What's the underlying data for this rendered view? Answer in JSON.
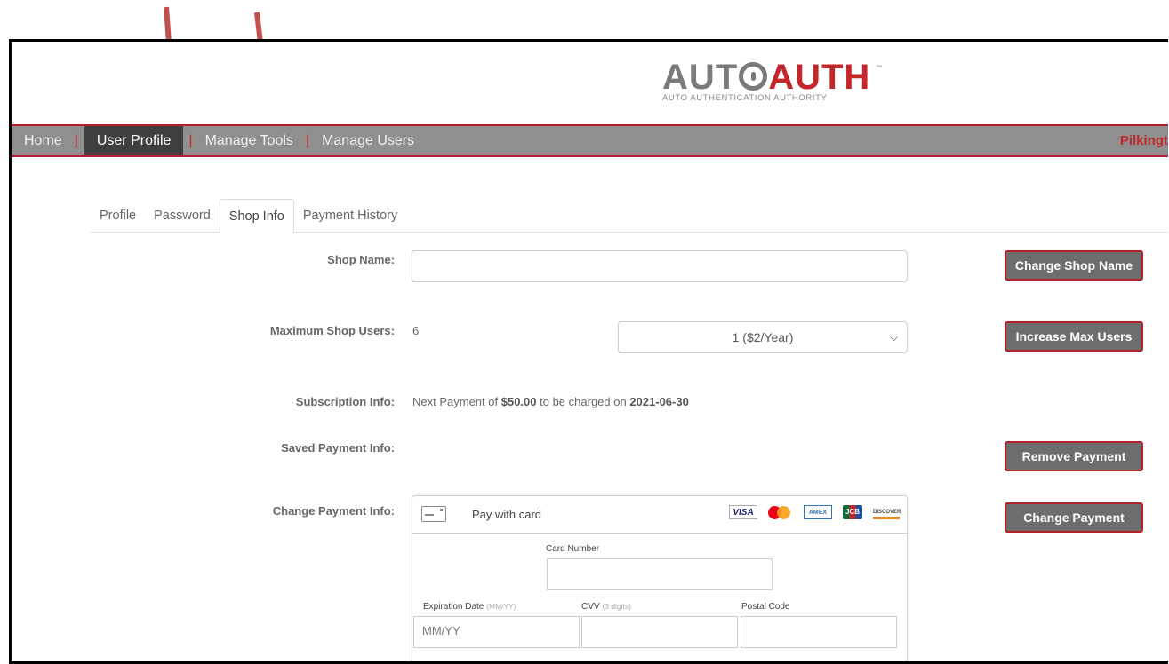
{
  "logo": {
    "part1": "AUT",
    "part2": "AUTH",
    "tm": "™",
    "subtitle": "AUTO AUTHENTICATION AUTHORITY"
  },
  "nav": {
    "items": [
      {
        "label": "Home"
      },
      {
        "label": "User Profile"
      },
      {
        "label": "Manage Tools"
      },
      {
        "label": "Manage Users"
      }
    ],
    "separator": "|",
    "user": "Pilkingt"
  },
  "tabs": [
    {
      "label": "Profile"
    },
    {
      "label": "Password"
    },
    {
      "label": "Shop Info"
    },
    {
      "label": "Payment History"
    }
  ],
  "shop": {
    "name_label": "Shop Name:",
    "name_value": "",
    "change_name_button": "Change Shop Name",
    "max_users_label": "Maximum Shop Users:",
    "max_users_value": "6",
    "max_users_select": "1 ($2/Year)",
    "increase_button": "Increase Max Users",
    "subscription_label": "Subscription Info:",
    "subscription_prefix": "Next Payment of",
    "subscription_amount": "$50.00",
    "subscription_middle": "to be charged on",
    "subscription_date": "2021-06-30",
    "saved_payment_label": "Saved Payment Info:",
    "remove_payment_button": "Remove Payment",
    "change_payment_label": "Change Payment Info:",
    "change_payment_button": "Change Payment"
  },
  "card_form": {
    "title": "Pay with card",
    "brands": [
      "VISA",
      "AMEX",
      "JCB",
      "DISCOVER"
    ],
    "card_number_label": "Card Number",
    "expiration_label": "Expiration Date",
    "expiration_hint": "(MM/YY)",
    "expiration_placeholder": "MM/YY",
    "cvv_label": "CVV",
    "cvv_hint": "(3 digits)",
    "postal_label": "Postal Code"
  },
  "colors": {
    "accent": "#b32228",
    "nav_bg": "#8f8f8f",
    "nav_active": "#3f3f3f",
    "button_bg": "#6d6d6d",
    "arrow": "#c0504d"
  }
}
